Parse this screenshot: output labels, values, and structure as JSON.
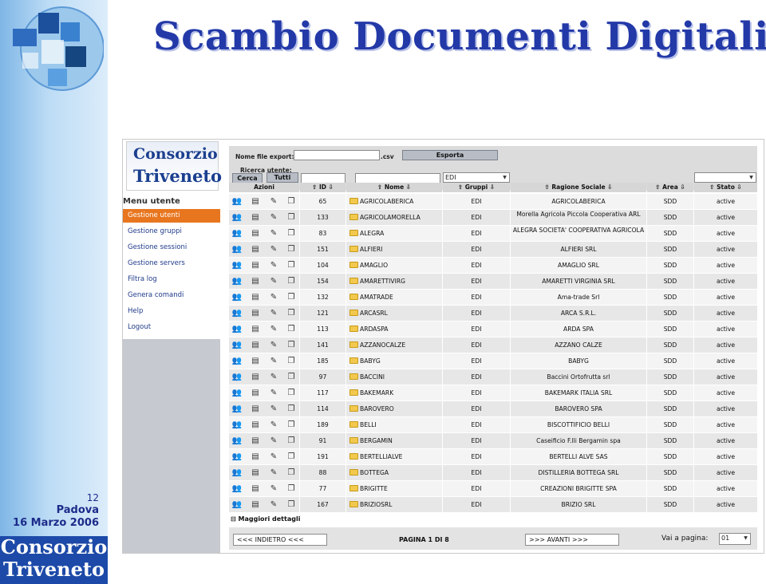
{
  "slide": {
    "title": "Scambio Documenti Digitali",
    "page_number": "12",
    "city": "Padova",
    "date": "16 Marzo 2006",
    "logo_line1": "Consorzio",
    "logo_line2": "Triveneto"
  },
  "app": {
    "logo_line1": "Consorzio",
    "logo_line2": "Triveneto",
    "menu_title": "Menu utente",
    "menu_items": [
      "Gestione utenti",
      "Gestione gruppi",
      "Gestione sessioni",
      "Gestione servers",
      "Filtra log",
      "Genera comandi",
      "Help",
      "Logout"
    ],
    "active_menu": "Gestione utenti"
  },
  "toolbar": {
    "export_label": "Nome file export:",
    "export_ext": ".csv",
    "export_button": "Esporta",
    "search_label": "Ricerca utente:",
    "search_button": "Cerca",
    "all_button": "Tutti",
    "group_filter_value": "EDI"
  },
  "columns": {
    "actions": "Azioni",
    "id": "ID",
    "name": "Nome",
    "groups": "Gruppi",
    "company": "Ragione Sociale",
    "area": "Area",
    "status": "Stato"
  },
  "rows": [
    {
      "id": "65",
      "name": "AGRICOLABERICA",
      "group": "EDI",
      "company": "AGRICOLABERICA",
      "area": "SDD",
      "status": "active"
    },
    {
      "id": "133",
      "name": "AGRICOLAMORELLA",
      "group": "EDI",
      "company": "Morella Agricola Piccola Cooperativa ARL",
      "area": "SDD",
      "status": "active"
    },
    {
      "id": "83",
      "name": "ALEGRA",
      "group": "EDI",
      "company": "ALEGRA SOCIETA' COOPERATIVA AGRICOLA",
      "area": "SDD",
      "status": "active"
    },
    {
      "id": "151",
      "name": "ALFIERI",
      "group": "EDI",
      "company": "ALFIERI SRL",
      "area": "SDD",
      "status": "active"
    },
    {
      "id": "104",
      "name": "AMAGLIO",
      "group": "EDI",
      "company": "AMAGLIO SRL",
      "area": "SDD",
      "status": "active"
    },
    {
      "id": "154",
      "name": "AMARETTIVIRG",
      "group": "EDI",
      "company": "AMARETTI VIRGINIA SRL",
      "area": "SDD",
      "status": "active"
    },
    {
      "id": "132",
      "name": "AMATRADE",
      "group": "EDI",
      "company": "Ama-trade Srl",
      "area": "SDD",
      "status": "active"
    },
    {
      "id": "121",
      "name": "ARCASRL",
      "group": "EDI",
      "company": "ARCA S.R.L.",
      "area": "SDD",
      "status": "active"
    },
    {
      "id": "113",
      "name": "ARDASPA",
      "group": "EDI",
      "company": "ARDA SPA",
      "area": "SDD",
      "status": "active"
    },
    {
      "id": "141",
      "name": "AZZANOCALZE",
      "group": "EDI",
      "company": "AZZANO CALZE",
      "area": "SDD",
      "status": "active"
    },
    {
      "id": "185",
      "name": "BABYG",
      "group": "EDI",
      "company": "BABYG",
      "area": "SDD",
      "status": "active"
    },
    {
      "id": "97",
      "name": "BACCINI",
      "group": "EDI",
      "company": "Baccini Ortofrutta srl",
      "area": "SDD",
      "status": "active"
    },
    {
      "id": "117",
      "name": "BAKEMARK",
      "group": "EDI",
      "company": "BAKEMARK ITALIA SRL",
      "area": "SDD",
      "status": "active"
    },
    {
      "id": "114",
      "name": "BAROVERO",
      "group": "EDI",
      "company": "BAROVERO SPA",
      "area": "SDD",
      "status": "active"
    },
    {
      "id": "189",
      "name": "BELLI",
      "group": "EDI",
      "company": "BISCOTTIFICIO BELLI",
      "area": "SDD",
      "status": "active"
    },
    {
      "id": "91",
      "name": "BERGAMIN",
      "group": "EDI",
      "company": "Caseificio F.lli Bergamin spa",
      "area": "SDD",
      "status": "active"
    },
    {
      "id": "191",
      "name": "BERTELLIALVE",
      "group": "EDI",
      "company": "BERTELLI ALVE SAS",
      "area": "SDD",
      "status": "active"
    },
    {
      "id": "88",
      "name": "BOTTEGA",
      "group": "EDI",
      "company": "DISTILLERIA BOTTEGA SRL",
      "area": "SDD",
      "status": "active"
    },
    {
      "id": "77",
      "name": "BRIGITTE",
      "group": "EDI",
      "company": "CREAZIONI BRIGITTE SPA",
      "area": "SDD",
      "status": "active"
    },
    {
      "id": "167",
      "name": "BRIZIOSRL",
      "group": "EDI",
      "company": "BRIZIO SRL",
      "area": "SDD",
      "status": "active"
    }
  ],
  "footer": {
    "more_details": "Maggiori dettagli",
    "back_button": "<<< INDIETRO <<<",
    "page_info": "PAGINA 1 DI 8",
    "next_button": ">>> AVANTI >>>",
    "goto_label": "Vai a pagina:",
    "goto_value": "01"
  },
  "icons": [
    "user-icon",
    "document-icon",
    "edit-icon",
    "copy-icon",
    "folder-icon",
    "sort-arrow-icon",
    "dropdown-arrow-icon",
    "expand-icon",
    "globe-logo-icon"
  ]
}
